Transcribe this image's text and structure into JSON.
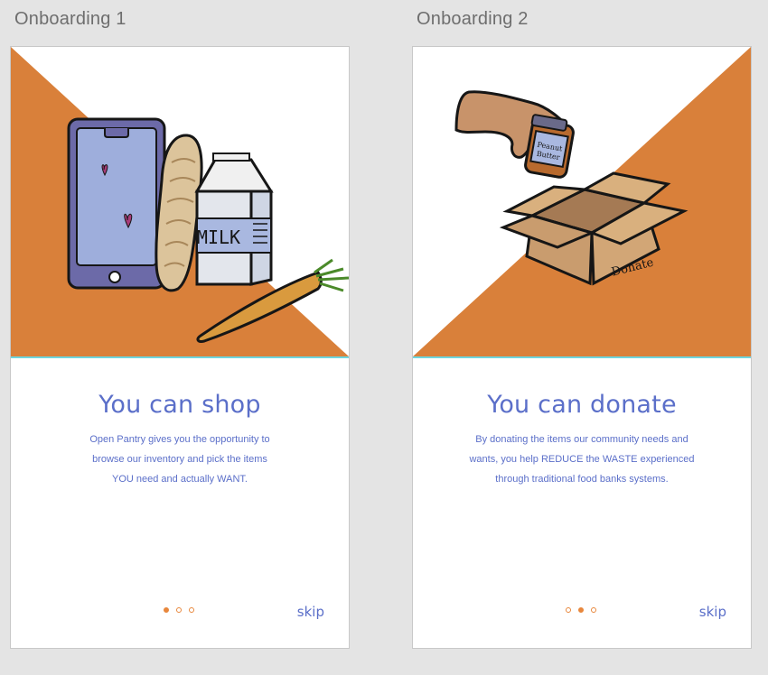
{
  "colors": {
    "accent_orange": "#d9803a",
    "text_blue": "#5b6fc9",
    "divider_teal": "#6fd6dd",
    "canvas_bg": "#e4e4e4"
  },
  "frames": [
    {
      "label": "Onboarding 1",
      "title": "You can shop",
      "body_lines": [
        "Open Pantry gives you the opportunity to",
        "browse our inventory and pick the items",
        "YOU need and actually WANT."
      ],
      "active_page": 1,
      "page_count": 3,
      "skip_label": "skip",
      "illustration": "phone-bread-milk-carrot-illustration",
      "illustration_text": "MILK"
    },
    {
      "label": "Onboarding 2",
      "title": "You can donate",
      "body_lines": [
        "By donating the items our community needs and",
        "wants, you help REDUCE the WASTE experienced",
        "through traditional food banks systems."
      ],
      "active_page": 2,
      "page_count": 3,
      "skip_label": "skip",
      "illustration": "hand-jar-donate-box-illustration",
      "illustration_text": [
        "Peanut",
        "Butter",
        "Donate"
      ]
    }
  ]
}
